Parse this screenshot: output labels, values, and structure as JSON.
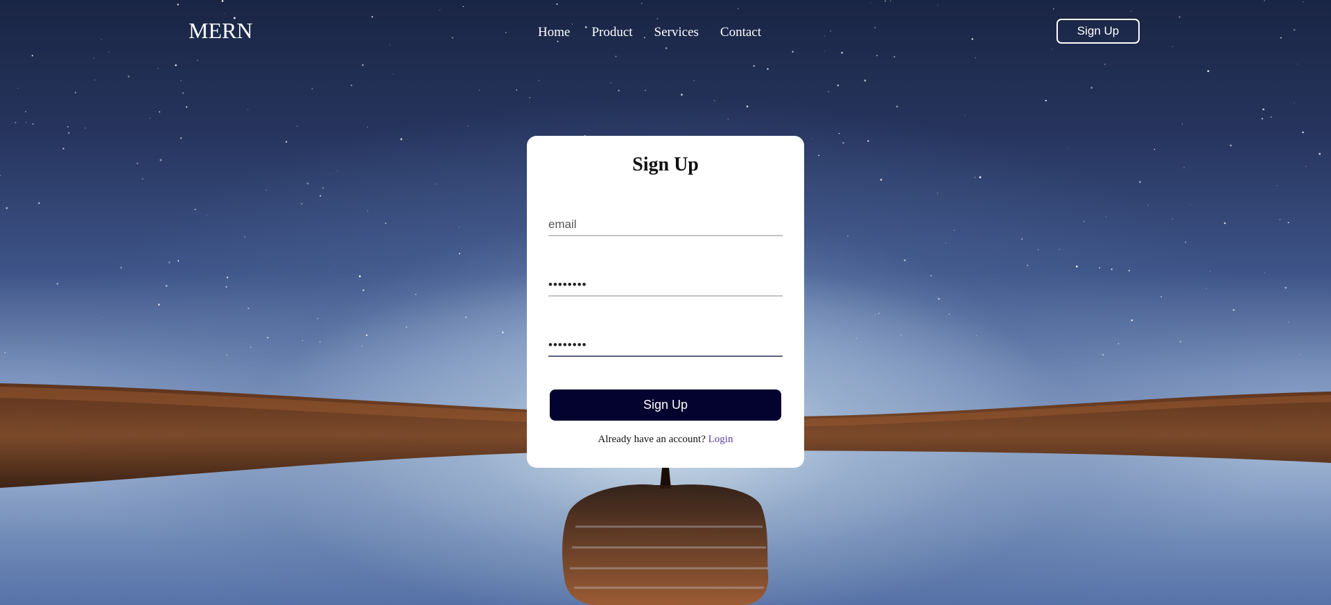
{
  "navbar": {
    "logo": "MERN",
    "links": [
      "Home",
      "Product",
      "Services",
      "Contact"
    ],
    "signup_label": "Sign Up"
  },
  "form": {
    "title": "Sign Up",
    "email_placeholder": "email",
    "password_value": "password",
    "confirm_password_value": "password",
    "submit_label": "Sign Up",
    "footer_prompt": "Already have an account?",
    "login_label": "Login"
  },
  "colors": {
    "submit_button": "#04022e",
    "login_link": "#5b3a9a",
    "treeline": "#6b3a1c"
  }
}
